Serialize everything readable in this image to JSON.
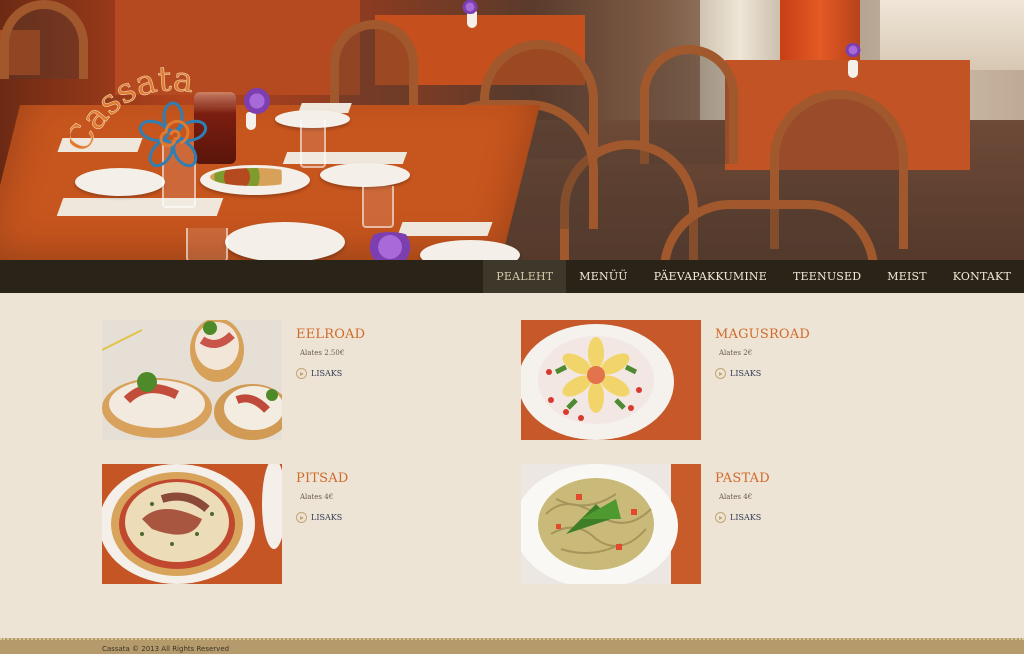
{
  "brand": {
    "logo_text": "Cassata",
    "colors": {
      "logo_orange": "#e07a30",
      "logo_blue": "#2f7fb5"
    }
  },
  "nav": {
    "items": [
      {
        "label": "PEALEHT",
        "active": true
      },
      {
        "label": "MENÜÜ",
        "active": false
      },
      {
        "label": "PÄEVAPAKKUMINE",
        "active": false
      },
      {
        "label": "TEENUSED",
        "active": false
      },
      {
        "label": "MEIST",
        "active": false
      },
      {
        "label": "KONTAKT",
        "active": false
      }
    ]
  },
  "categories": [
    {
      "title": "EELROAD",
      "price": "Alates 2.50€",
      "more": "LISAKS",
      "image": "bruschetta-photo"
    },
    {
      "title": "MAGUSROAD",
      "price": "Alates 2€",
      "more": "LISAKS",
      "image": "cake-photo"
    },
    {
      "title": "PITSAD",
      "price": "Alates 4€",
      "more": "LISAKS",
      "image": "pizza-photo"
    },
    {
      "title": "PASTAD",
      "price": "Alates 4€",
      "more": "LISAKS",
      "image": "pasta-photo"
    }
  ],
  "footer": {
    "copyright": "Cassata © 2013 All Rights Reserved"
  },
  "colors": {
    "page_bg": "#ede4d6",
    "nav_bg": "#2a2418",
    "title_orange": "#d16a2a",
    "footer_bg": "#b59a6b"
  }
}
